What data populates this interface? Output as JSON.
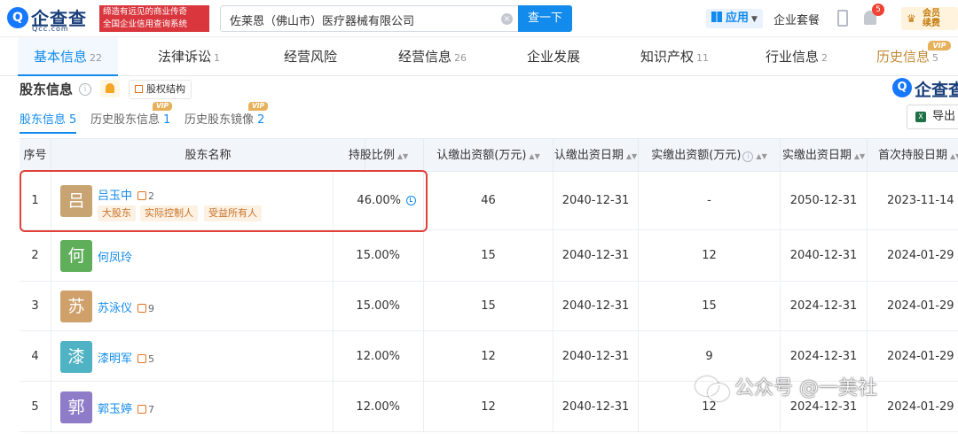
{
  "header": {
    "logo_text": "企查查",
    "logo_sub": "Qcc.com",
    "slogan_line1": "缔造有远见的商业传奇",
    "slogan_line2": "全国企业信用查询系统",
    "search_value": "佐莱恩（佛山市）医疗器械有限公司",
    "search_button": "查一下",
    "apps_label": "应用",
    "suite_label": "企业套餐",
    "notification_count": "5",
    "member_line1": "会员",
    "member_line2": "续费"
  },
  "nav": {
    "tabs": [
      {
        "label": "基本信息",
        "count": "22"
      },
      {
        "label": "法律诉讼",
        "count": "1"
      },
      {
        "label": "经营风险",
        "count": ""
      },
      {
        "label": "经营信息",
        "count": "26"
      },
      {
        "label": "企业发展",
        "count": ""
      },
      {
        "label": "知识产权",
        "count": "11"
      },
      {
        "label": "行业信息",
        "count": "2"
      },
      {
        "label": "历史信息",
        "count": "5"
      }
    ],
    "vip_label": "VIP"
  },
  "section": {
    "title": "股东信息",
    "structure_label": "股权结构",
    "brand_text": "企查查",
    "subtabs": [
      {
        "label": "股东信息",
        "count": "5"
      },
      {
        "label": "历史股东信息",
        "count": "1"
      },
      {
        "label": "历史股东镜像",
        "count": "2"
      }
    ],
    "vip_label": "VIP",
    "export_label": "导出"
  },
  "table": {
    "headers": [
      "序号",
      "股东名称",
      "持股比例",
      "认缴出资额(万元)",
      "认缴出资日期",
      "实缴出资额(万元)",
      "实缴出资日期",
      "首次持股日期"
    ],
    "rows": [
      {
        "index": "1",
        "avatar": "吕",
        "avatar_color": "#c9a473",
        "name": "吕玉中",
        "relations": "2",
        "tags": [
          "大股东",
          "实际控制人",
          "受益所有人"
        ],
        "ratio": "46.00%",
        "subscribed": "46",
        "subscribed_date": "2040-12-31",
        "paid": "-",
        "paid_date": "2050-12-31",
        "first_date": "2023-11-14"
      },
      {
        "index": "2",
        "avatar": "何",
        "avatar_color": "#5fae5a",
        "name": "何凤玲",
        "relations": "",
        "tags": [],
        "ratio": "15.00%",
        "subscribed": "15",
        "subscribed_date": "2040-12-31",
        "paid": "12",
        "paid_date": "2040-12-31",
        "first_date": "2024-01-29"
      },
      {
        "index": "3",
        "avatar": "苏",
        "avatar_color": "#cfa06a",
        "name": "苏泳仪",
        "relations": "9",
        "tags": [],
        "ratio": "15.00%",
        "subscribed": "15",
        "subscribed_date": "2040-12-31",
        "paid": "15",
        "paid_date": "2024-12-31",
        "first_date": "2024-01-29"
      },
      {
        "index": "4",
        "avatar": "漆",
        "avatar_color": "#4fb3c4",
        "name": "漆明军",
        "relations": "5",
        "tags": [],
        "ratio": "12.00%",
        "subscribed": "12",
        "subscribed_date": "2040-12-31",
        "paid": "9",
        "paid_date": "2024-12-31",
        "first_date": "2024-01-29"
      },
      {
        "index": "5",
        "avatar": "郭",
        "avatar_color": "#8f7cc9",
        "name": "郭玉婷",
        "relations": "7",
        "tags": [],
        "ratio": "12.00%",
        "subscribed": "12",
        "subscribed_date": "2040-12-31",
        "paid": "12",
        "paid_date": "2024-12-31",
        "first_date": "2024-01-29"
      }
    ]
  },
  "watermark": "公众号 @一美社"
}
